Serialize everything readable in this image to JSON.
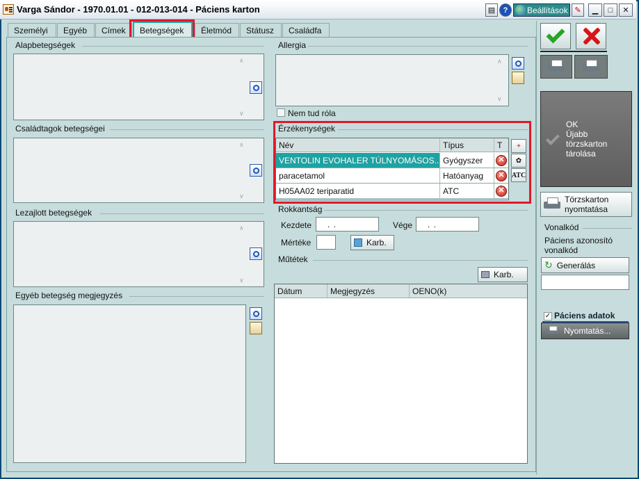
{
  "window": {
    "title": "Varga Sándor - 1970.01.01 - 012-013-014 - Páciens karton"
  },
  "titlebar": {
    "settings_label": "Beállítások"
  },
  "tabs": [
    {
      "label": "Személyi"
    },
    {
      "label": "Egyéb"
    },
    {
      "label": "Címek"
    },
    {
      "label": "Betegségek",
      "active": true
    },
    {
      "label": "Életmód"
    },
    {
      "label": "Státusz"
    },
    {
      "label": "Családfa"
    }
  ],
  "sections": {
    "basic_diseases": "Alapbetegségek",
    "family_diseases": "Családtagok betegségei",
    "closed_diseases": "Lezajlott betegségek",
    "other_note": "Egyéb betegség megjegyzés",
    "allergy": "Allergia",
    "allergy_unknown": "Nem tud róla",
    "sensitivities": "Érzékenységek",
    "disability": "Rokkantság",
    "surgeries": "Műtétek"
  },
  "sensitivity_table": {
    "headers": [
      "Név",
      "Típus",
      "T"
    ],
    "rows": [
      {
        "name": "VENTOLIN EVOHALER TÚLNYOMÁSOS...",
        "type": "Gyógyszer",
        "selected": true
      },
      {
        "name": "paracetamol",
        "type": "Hatóanyag",
        "selected": false
      },
      {
        "name": "H05AA02 teriparatid",
        "type": "ATC",
        "selected": false
      }
    ],
    "atc_button": "ATC"
  },
  "disability": {
    "start_label": "Kezdete",
    "start_value": ". .",
    "end_label": "Vége",
    "end_value": ". .",
    "degree_label": "Mértéke",
    "degree_value": "",
    "edit_button": "Karb."
  },
  "surgeries": {
    "edit_button": "Karb.",
    "headers": [
      "Dátum",
      "Megjegyzés",
      "OENO(k)"
    ]
  },
  "right_panel": {
    "ok_label": "OK",
    "ok_line2": "Újabb",
    "ok_line3": "törzskarton",
    "ok_line4": "tárolása",
    "print_card_line1": "Törzskarton",
    "print_card_line2": "nyomtatása",
    "barcode_title": "Vonalkód",
    "barcode_desc_line1": "Páciens azonosító",
    "barcode_desc_line2": "vonalkód",
    "generate_button": "Generálás",
    "patient_data_label": "Páciens adatok",
    "print_button": "Nyomtatás..."
  },
  "colors": {
    "accent": "#1ea2a2",
    "highlight": "#e0182a",
    "background": "#c7dcdc"
  }
}
